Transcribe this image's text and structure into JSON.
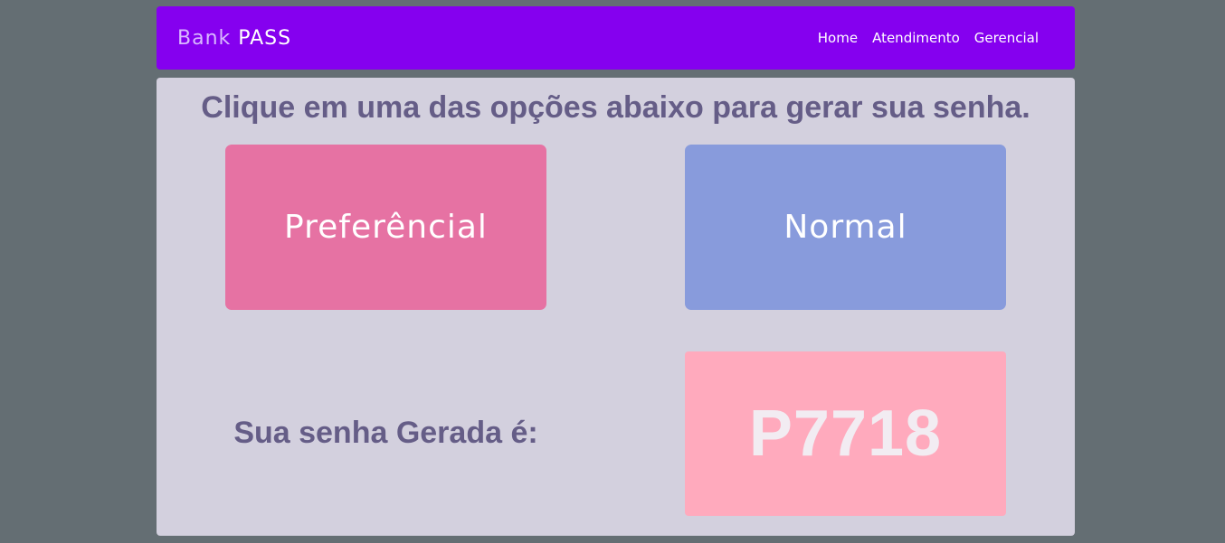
{
  "navbar": {
    "brand_light": "Bank",
    "brand_strong": "PASS",
    "links": [
      {
        "label": "Home"
      },
      {
        "label": "Atendimento"
      },
      {
        "label": "Gerencial"
      }
    ]
  },
  "main": {
    "headline": "Clique em uma das opções abaixo para gerar sua senha.",
    "options": {
      "preferencial": "Preferêncial",
      "normal": "Normal"
    },
    "result_label": "Sua senha Gerada é:",
    "ticket_code": "P7718"
  },
  "colors": {
    "page_bg": "#646e73",
    "navbar_bg": "#8500ef",
    "panel_bg": "#d3d0de",
    "text_primary": "#655d87",
    "preferencial_bg": "#e672a3",
    "normal_bg": "#889bdc",
    "ticket_bg": "#ffaabd"
  }
}
